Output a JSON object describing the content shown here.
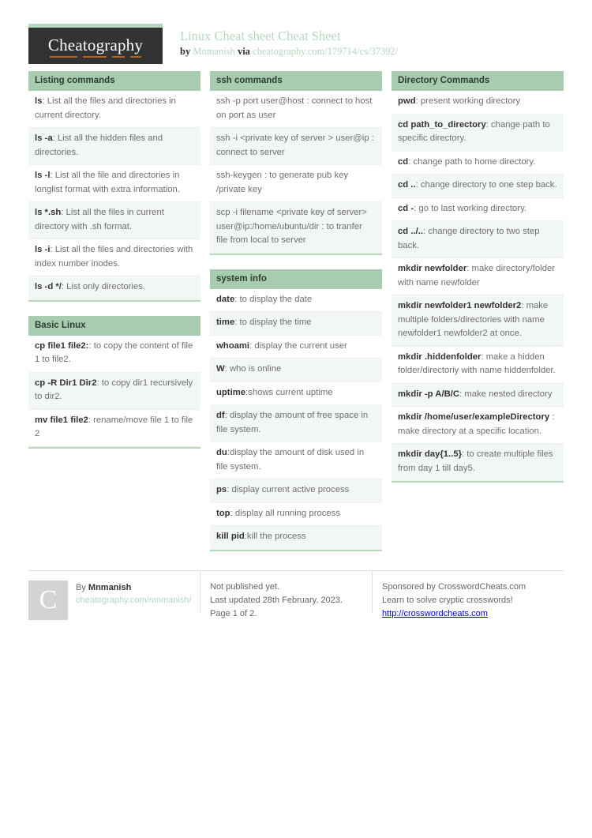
{
  "brand": {
    "logo_text": "Cheatography",
    "accent_green": "#a8ccb0",
    "accent_orange": "#b5651d",
    "logo_bg": "#333333"
  },
  "header": {
    "title": "Linux Cheat sheet Cheat Sheet",
    "by_label": "by",
    "author": "Mnmanish",
    "via_label": "via",
    "source_url": "cheatography.com/179714/cs/37392/"
  },
  "columns": [
    {
      "tables": [
        {
          "title": "Listing commands",
          "rows": [
            {
              "cmd": "ls",
              "desc": ": List all the files and directories in current directory."
            },
            {
              "cmd": "ls -a",
              "desc": ": List all the hidden files and directories."
            },
            {
              "cmd": "ls -l",
              "desc": ": List all the file and directories in longlist format with extra information."
            },
            {
              "cmd": "ls *.sh",
              "desc": ": List all the files in current directory with .sh format."
            },
            {
              "cmd": "ls -i",
              "desc": ": List all the files and directories with index number inodes."
            },
            {
              "cmd": "ls -d */",
              "desc": ": List only directories."
            }
          ]
        },
        {
          "title": "Basic Linux",
          "rows": [
            {
              "cmd": "cp file1 file2:",
              "desc": ": to copy the content of file 1 to file2."
            },
            {
              "cmd": "cp -R Dir1 Dir2",
              "desc": ": to copy dir1 recursively to dir2."
            },
            {
              "cmd": "mv file1 file2",
              "desc": ": rename/move file 1 to file 2"
            }
          ]
        }
      ]
    },
    {
      "tables": [
        {
          "title": "ssh commands",
          "rows": [
            {
              "cmd": "",
              "desc": "ssh -p port user@host : connect to host on port as user"
            },
            {
              "cmd": "",
              "desc": "ssh -i <private key of server > user@ip : connect to server"
            },
            {
              "cmd": "",
              "desc": "ssh-keygen : to generate pub key /private key"
            },
            {
              "cmd": "",
              "desc": "scp -i filename <private key of server> user@ip:/home/ubuntu/dir : to tranfer file from local to server"
            }
          ]
        },
        {
          "title": "system info",
          "rows": [
            {
              "cmd": "date",
              "desc": ": to display the date"
            },
            {
              "cmd": "time",
              "desc": ": to display the time"
            },
            {
              "cmd": "whoami",
              "desc": ": display the current user"
            },
            {
              "cmd": "W",
              "desc": ": who is online"
            },
            {
              "cmd": "uptime",
              "desc": ":shows current uptime"
            },
            {
              "cmd": "df",
              "desc": ": display the amount of free space in file system."
            },
            {
              "cmd": "du",
              "desc": ":display the amount of disk used in file system."
            },
            {
              "cmd": "ps",
              "desc": ": display current active process"
            },
            {
              "cmd": "top",
              "desc": ": display all running process"
            },
            {
              "cmd": "kill pid",
              "desc": ":kill the process"
            }
          ]
        }
      ]
    },
    {
      "tables": [
        {
          "title": "Directory Commands",
          "rows": [
            {
              "cmd": "pwd",
              "desc": ": present working directory"
            },
            {
              "cmd": "cd path_to_directory",
              "desc": ": change path to specific directory."
            },
            {
              "cmd": "cd",
              "desc": ": change path to home directory."
            },
            {
              "cmd": "cd ..",
              "desc": ": change directory to one step back."
            },
            {
              "cmd": "cd -",
              "desc": ": go to last working directory."
            },
            {
              "cmd": "cd ../..",
              "desc": ": change directory to two step back."
            },
            {
              "cmd": "mkdir newfolder",
              "desc": ": make directory/folder with name newfolder"
            },
            {
              "cmd": "mkdir newfolder1 newfolder2",
              "desc": ": make multiple folders/directories with name newfolder1 newfolder2 at once."
            },
            {
              "cmd": "mkdir .hiddenfolder",
              "desc": ": make a hidden folder/directoriy with name hiddenfolder."
            },
            {
              "cmd": "mkdir -p A/B/C",
              "desc": ": make nested directory"
            },
            {
              "cmd": "mkdir /home/user/exampleDirectory",
              "desc": " : make directory at a specific location."
            },
            {
              "cmd": "mkdir day{1..5}",
              "desc": ": to create multiple files from day 1 till day5."
            }
          ]
        }
      ]
    }
  ],
  "footer": {
    "author_block": {
      "avatar_letter": "C",
      "by_label": "By ",
      "author": "Mnmanish",
      "profile_url": "cheatography.com/mnmanish/"
    },
    "publish_block": {
      "line1": "Not published yet.",
      "line2": "Last updated 28th February, 2023.",
      "line3": "Page 1 of 2."
    },
    "sponsor_block": {
      "prefix": "Sponsored by ",
      "sponsor": "CrosswordCheats.com",
      "tagline": "Learn to solve cryptic crosswords!",
      "url": "http://crosswordcheats.com"
    }
  }
}
